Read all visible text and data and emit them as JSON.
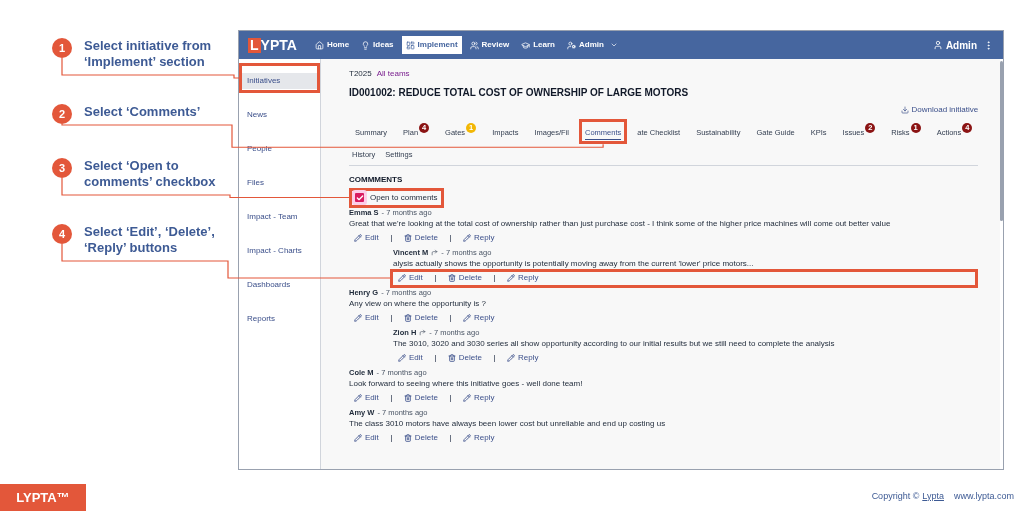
{
  "callouts": [
    {
      "number": "1",
      "text": "Select initiative from ‘Implement’ section"
    },
    {
      "number": "2",
      "text": "Select ‘Comments’"
    },
    {
      "number": "3",
      "text": "Select ‘Open to comments’ checkbox"
    },
    {
      "number": "4",
      "text": "Select ‘Edit’, ‘Delete’, ‘Reply’ buttons"
    }
  ],
  "app": {
    "logo": "LYPTA",
    "nav": [
      {
        "label": "Home",
        "selected": false,
        "dropdown": false
      },
      {
        "label": "Ideas",
        "selected": false,
        "dropdown": false
      },
      {
        "label": "Implement",
        "selected": true,
        "dropdown": false
      },
      {
        "label": "Review",
        "selected": false,
        "dropdown": false
      },
      {
        "label": "Learn",
        "selected": false,
        "dropdown": false
      },
      {
        "label": "Admin",
        "selected": false,
        "dropdown": true
      }
    ],
    "user": "Admin",
    "sidebar": [
      {
        "label": "Initiatives",
        "selected": true,
        "highlighted": true
      },
      {
        "label": "News",
        "selected": false,
        "highlighted": false
      },
      {
        "label": "People",
        "selected": false,
        "highlighted": false
      },
      {
        "label": "Files",
        "selected": false,
        "highlighted": false
      },
      {
        "label": "Impact - Team",
        "selected": false,
        "highlighted": false
      },
      {
        "label": "Impact - Charts",
        "selected": false,
        "highlighted": false
      },
      {
        "label": "Dashboards",
        "selected": false,
        "highlighted": false
      },
      {
        "label": "Reports",
        "selected": false,
        "highlighted": false
      }
    ],
    "team": "T2025",
    "team_link": "All teams",
    "title": "ID001002: REDUCE TOTAL COST OF OWNERSHIP OF LARGE MOTORS",
    "download": "Download initiative",
    "tabs": [
      {
        "label": "Summary",
        "selected": false,
        "highlighted": false
      },
      {
        "label": "Plan",
        "selected": false,
        "highlighted": false,
        "badge": "4",
        "color": "#8b1414"
      },
      {
        "label": "Gates",
        "selected": false,
        "highlighted": false,
        "badge": "1",
        "color": "#f2b705"
      },
      {
        "label": "Impacts",
        "selected": false,
        "highlighted": false
      },
      {
        "label": "Images/Fil",
        "selected": false,
        "highlighted": false
      },
      {
        "label": "Comments",
        "selected": true,
        "highlighted": true
      },
      {
        "label": "ate Checklist",
        "selected": false,
        "highlighted": false
      },
      {
        "label": "Sustainability",
        "selected": false,
        "highlighted": false
      },
      {
        "label": "Gate Guide",
        "selected": false,
        "highlighted": false
      },
      {
        "label": "KPIs",
        "selected": false,
        "highlighted": false
      },
      {
        "label": "Issues",
        "selected": false,
        "highlighted": false,
        "badge": "2",
        "color": "#8b1414"
      },
      {
        "label": "Risks",
        "selected": false,
        "highlighted": false,
        "badge": "1",
        "color": "#8b1414"
      },
      {
        "label": "Actions",
        "selected": false,
        "highlighted": false,
        "badge": "4",
        "color": "#8b1414"
      }
    ],
    "subtabs": [
      "History",
      "Settings"
    ],
    "section_title": "COMMMENTS",
    "open_checkbox": {
      "label": "Open to comments",
      "checked": true,
      "highlighted": true
    },
    "comments": [
      {
        "author": "Emma S",
        "time": "- 7 months ago",
        "text": "Great that we're looking at the total cost of ownership rather than just purchase cost - I think some of the higher price machines will come out better value",
        "actions": [
          "Edit",
          "Delete",
          "Reply"
        ],
        "highlighted": false,
        "replies": [
          {
            "author": "Vincent M",
            "time": "- 7 months ago",
            "text": "alysis actually shows the opportunity is potentially moving away from the current 'lower' price motors...",
            "actions": [
              "Edit",
              "Delete",
              "Reply"
            ],
            "highlighted": true
          }
        ]
      },
      {
        "author": "Henry G",
        "time": "- 7 months ago",
        "text": "Any view on where the opportunity is ?",
        "actions": [
          "Edit",
          "Delete",
          "Reply"
        ],
        "highlighted": false,
        "replies": [
          {
            "author": "Zion H",
            "time": "- 7 months ago",
            "text": "The 3010, 3020 and 3030 series all show opportunity according to our initial results but we still need to complete the analysis",
            "actions": [
              "Edit",
              "Delete",
              "Reply"
            ],
            "highlighted": false
          }
        ]
      },
      {
        "author": "Cole M",
        "time": "- 7 months ago",
        "text": "Look forward to seeing where this initiative goes - well done team!",
        "actions": [
          "Edit",
          "Delete",
          "Reply"
        ],
        "highlighted": false
      },
      {
        "author": "Amy W",
        "time": "- 7 months ago",
        "text": "The class 3010 motors have always been lower cost but unreliable and end up costing us",
        "actions": [
          "Edit",
          "Delete",
          "Reply"
        ],
        "highlighted": false
      }
    ]
  },
  "footer": {
    "logo": "LYPTA™",
    "copyright": "Copyright ©",
    "copyright_link": "Lypta",
    "website": "www.lypta.com"
  }
}
